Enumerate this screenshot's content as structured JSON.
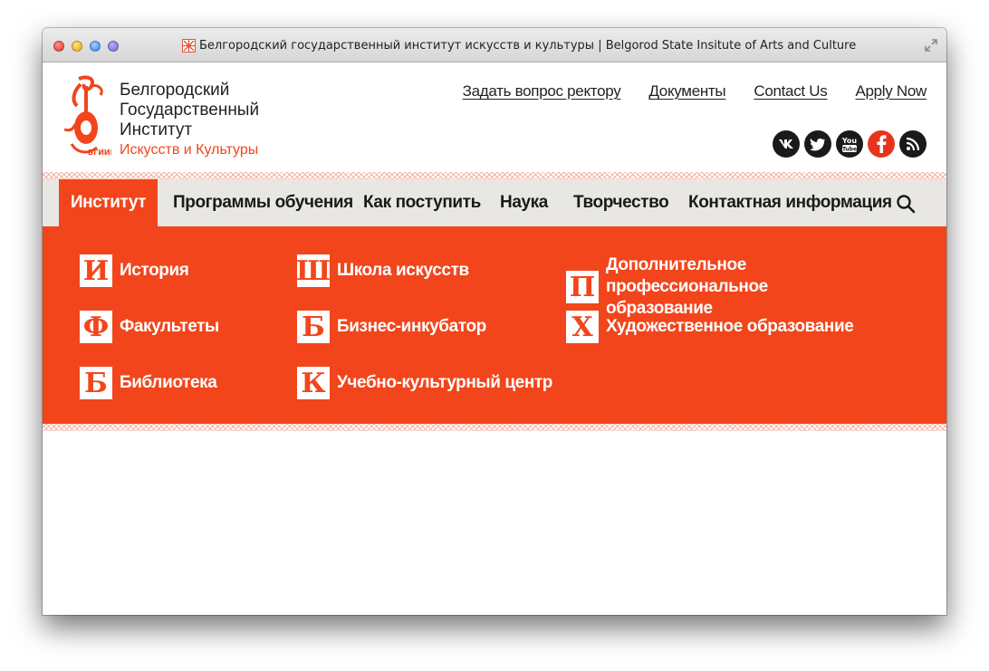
{
  "window": {
    "title": "Белгородский государственный институт искусств и культуры | Belgorod State Insitute of Arts and Culture"
  },
  "brand": {
    "line1": "Белгородский",
    "line2": "Государственный",
    "line3": "Институт",
    "line4": "Искусств и Культуры",
    "logo_caption": "БГИИК"
  },
  "top_links": [
    {
      "label": "Задать вопрос ректору"
    },
    {
      "label": "Документы"
    },
    {
      "label": "Contact Us"
    },
    {
      "label": "Apply Now"
    }
  ],
  "socials": [
    {
      "name": "vk-icon",
      "label": "vk"
    },
    {
      "name": "twitter-icon",
      "label": "twitter"
    },
    {
      "name": "youtube-icon",
      "label": "You Tube"
    },
    {
      "name": "facebook-icon",
      "label": "f"
    },
    {
      "name": "rss-icon",
      "label": "rss"
    }
  ],
  "nav": [
    {
      "label": "Институт",
      "active": true
    },
    {
      "label": "Программы обучения"
    },
    {
      "label": "Как поступить"
    },
    {
      "label": "Наука"
    },
    {
      "label": "Творчество"
    },
    {
      "label": "Контактная информация"
    }
  ],
  "menu": [
    {
      "letter": "И",
      "label": "История"
    },
    {
      "letter": "Ф",
      "label": "Факультеты"
    },
    {
      "letter": "Б",
      "label": "Библиотека"
    },
    {
      "letter": "Ш",
      "label": "Школа искусств"
    },
    {
      "letter": "Б",
      "label": "Бизнес-инкубатор"
    },
    {
      "letter": "К",
      "label": "Учебно-культурный центр"
    },
    {
      "letter": "П",
      "label": "Дополнительное профессиональное образование"
    },
    {
      "letter": "Х",
      "label": "Художественное образование"
    }
  ],
  "colors": {
    "accent": "#f2451c",
    "nav_bg": "#e8e7e3",
    "text": "#1a1a1a"
  }
}
